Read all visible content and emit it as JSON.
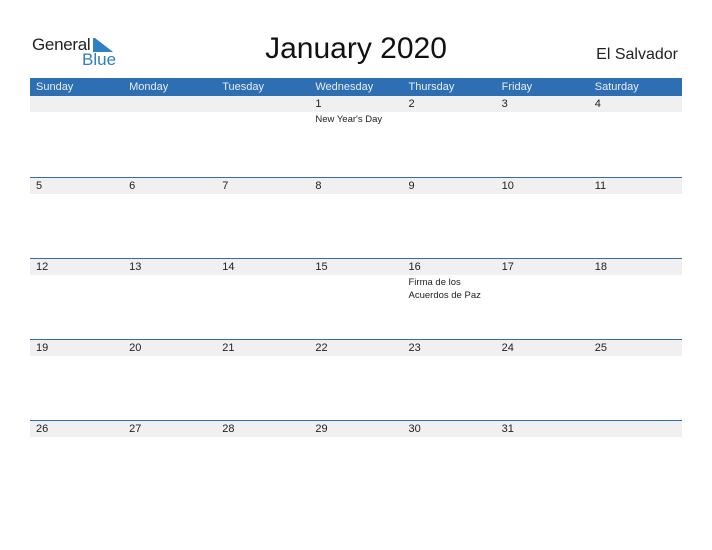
{
  "logo": {
    "word1": "General",
    "word2": "Blue"
  },
  "title": "January 2020",
  "country": "El Salvador",
  "colors": {
    "accent": "#2e6fb3",
    "row_band": "#f0f0f0"
  },
  "weekdays": [
    "Sunday",
    "Monday",
    "Tuesday",
    "Wednesday",
    "Thursday",
    "Friday",
    "Saturday"
  ],
  "weeks": [
    [
      {
        "d": ""
      },
      {
        "d": ""
      },
      {
        "d": ""
      },
      {
        "d": "1",
        "h": "New Year's Day"
      },
      {
        "d": "2"
      },
      {
        "d": "3"
      },
      {
        "d": "4"
      }
    ],
    [
      {
        "d": "5"
      },
      {
        "d": "6"
      },
      {
        "d": "7"
      },
      {
        "d": "8"
      },
      {
        "d": "9"
      },
      {
        "d": "10"
      },
      {
        "d": "11"
      }
    ],
    [
      {
        "d": "12"
      },
      {
        "d": "13"
      },
      {
        "d": "14"
      },
      {
        "d": "15"
      },
      {
        "d": "16",
        "h": "Firma de los Acuerdos de Paz"
      },
      {
        "d": "17"
      },
      {
        "d": "18"
      }
    ],
    [
      {
        "d": "19"
      },
      {
        "d": "20"
      },
      {
        "d": "21"
      },
      {
        "d": "22"
      },
      {
        "d": "23"
      },
      {
        "d": "24"
      },
      {
        "d": "25"
      }
    ],
    [
      {
        "d": "26"
      },
      {
        "d": "27"
      },
      {
        "d": "28"
      },
      {
        "d": "29"
      },
      {
        "d": "30"
      },
      {
        "d": "31"
      },
      {
        "d": ""
      }
    ]
  ]
}
